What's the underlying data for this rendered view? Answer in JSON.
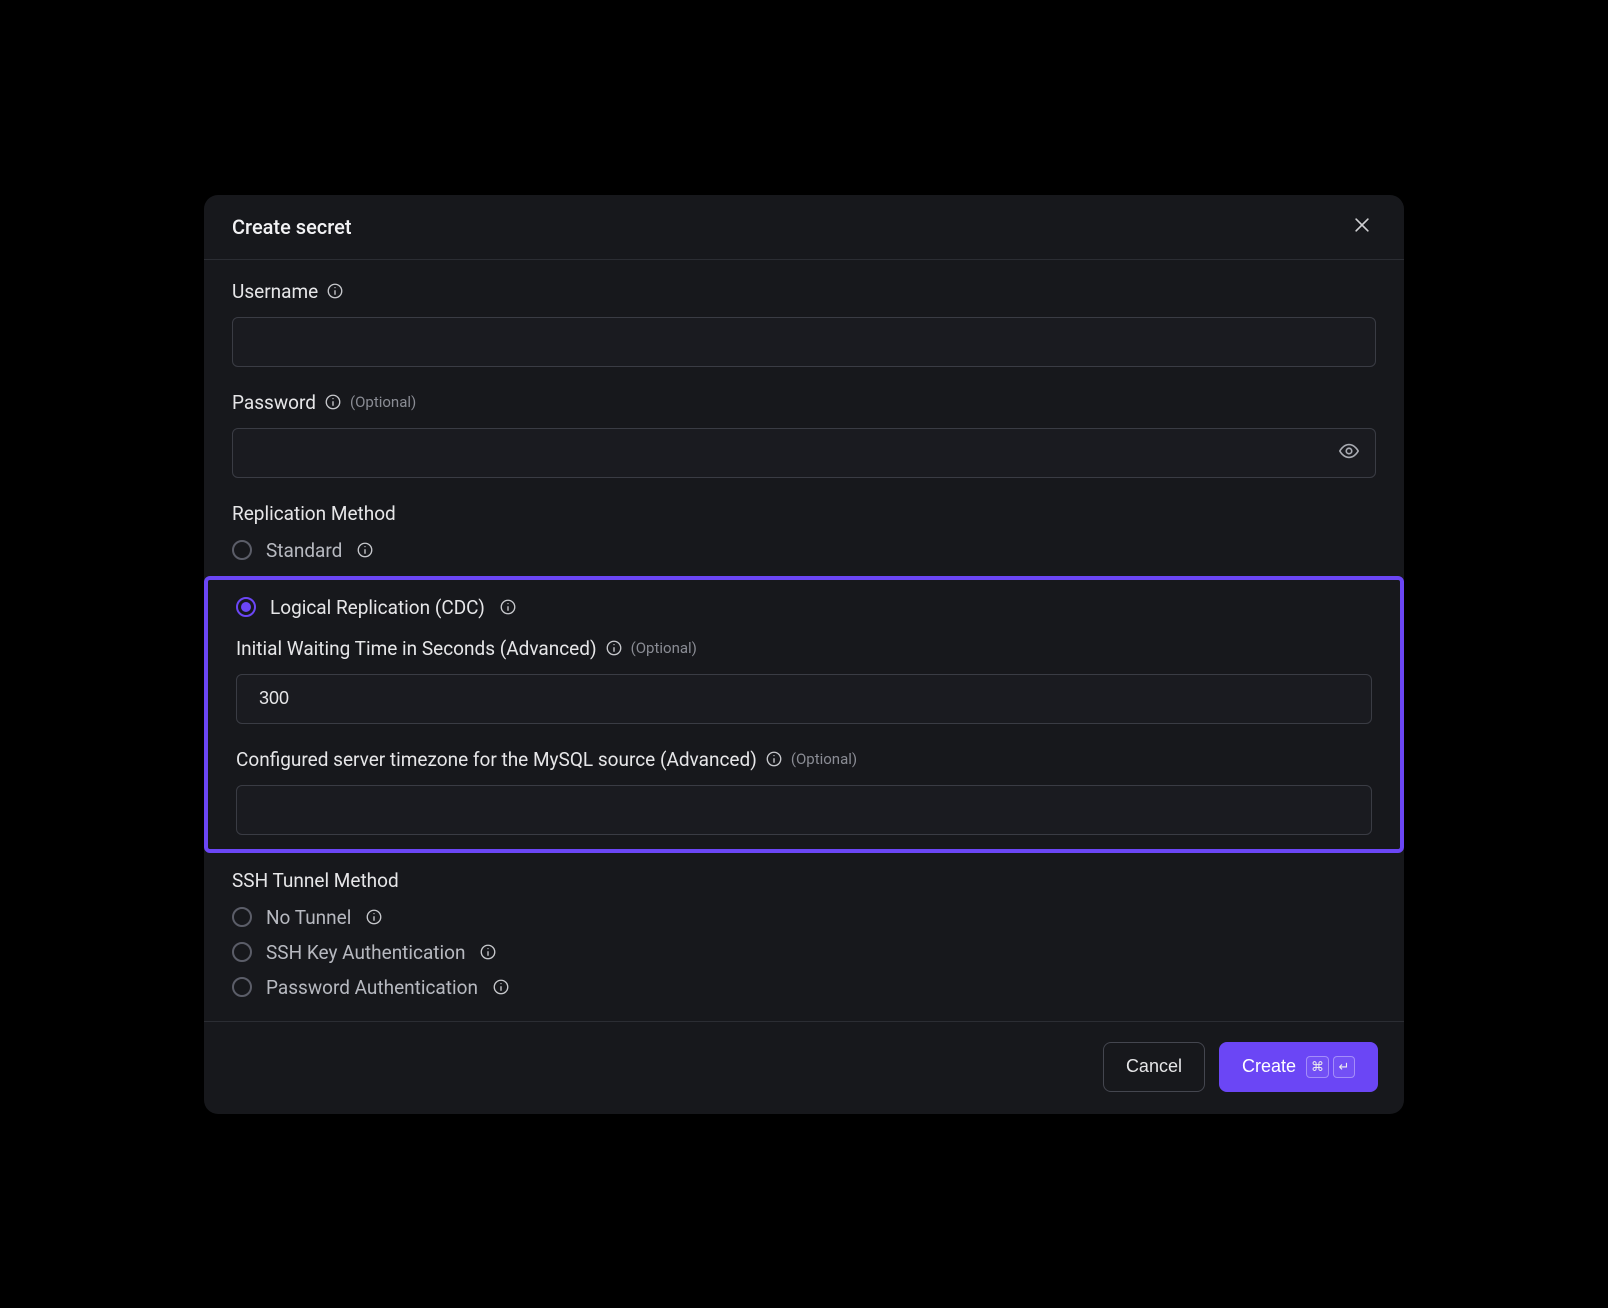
{
  "modal_title": "Create secret",
  "username": {
    "label": "Username",
    "value": ""
  },
  "password": {
    "label": "Password",
    "optional": "(Optional)",
    "value": ""
  },
  "replication": {
    "title": "Replication Method",
    "options": {
      "standard": "Standard",
      "cdc": "Logical Replication (CDC)"
    },
    "selected": "cdc"
  },
  "initial_wait": {
    "label": "Initial Waiting Time in Seconds (Advanced)",
    "optional": "(Optional)",
    "value": "300"
  },
  "timezone": {
    "label": "Configured server timezone for the MySQL source (Advanced)",
    "optional": "(Optional)",
    "value": ""
  },
  "ssh": {
    "title": "SSH Tunnel Method",
    "options": {
      "none": "No Tunnel",
      "key": "SSH Key Authentication",
      "password": "Password Authentication"
    }
  },
  "footer": {
    "cancel": "Cancel",
    "create": "Create",
    "shortcut": {
      "mod": "⌘",
      "enter": "↵"
    }
  }
}
